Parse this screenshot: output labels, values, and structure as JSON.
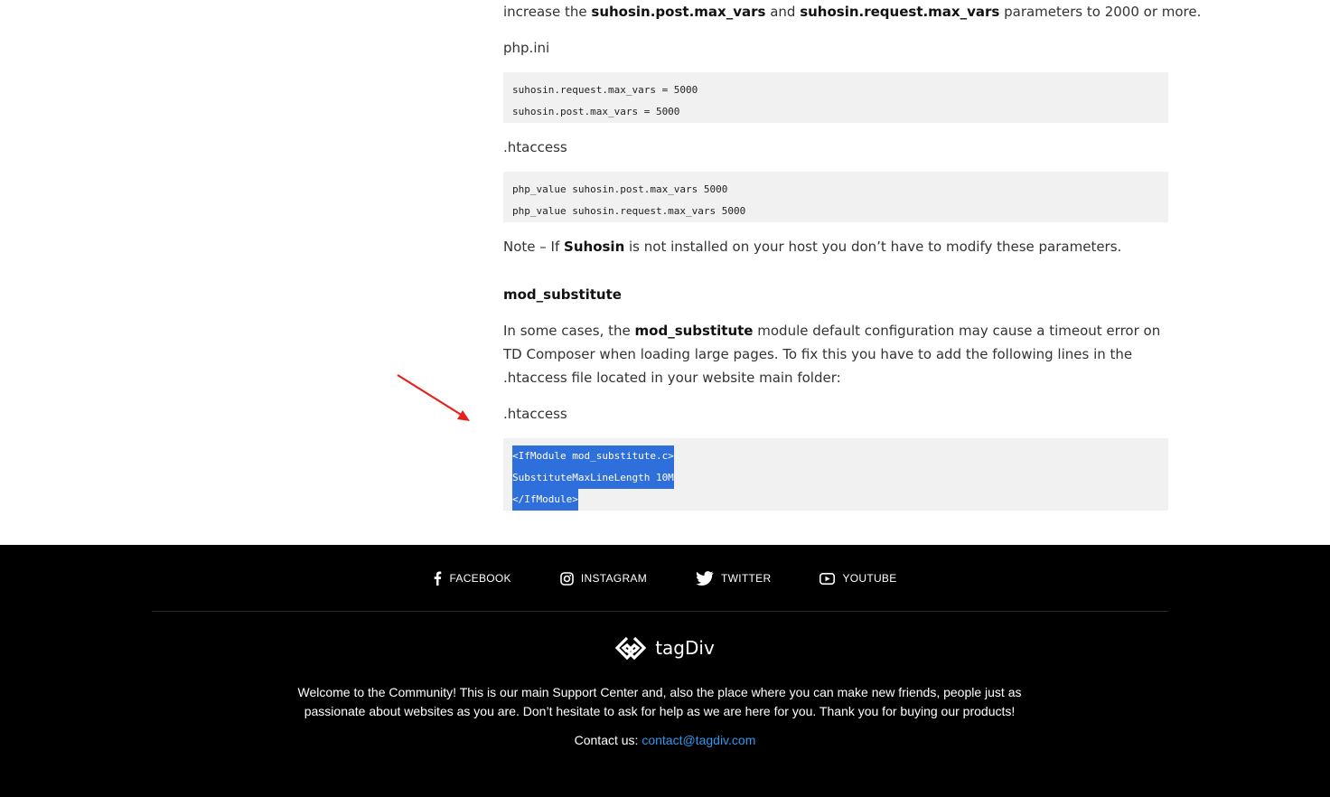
{
  "article": {
    "intro": {
      "pre": "increase the ",
      "b1": "suhosin.post.max_vars",
      "mid": " and ",
      "b2": "suhosin.request.max_vars",
      "post": " parameters to 2000 or more."
    },
    "phpini_label": "php.ini",
    "phpini_code": [
      "suhosin.request.max_vars = 5000",
      "suhosin.post.max_vars = 5000"
    ],
    "htaccess_label1": ".htaccess",
    "htaccess_code1": [
      "php_value suhosin.post.max_vars 5000",
      "php_value suhosin.request.max_vars 5000"
    ],
    "note": {
      "pre": "Note – If ",
      "b": "Suhosin",
      "post": " is not installed on your host you don’t have to modify these parameters."
    },
    "subheading": "mod_substitute",
    "paragraph": {
      "pre": "In some cases, the ",
      "b": "mod_substitute",
      "post": " module default configuration may cause a timeout error on TD Composer when loading large pages. To fix this you have to add the following lines in the .htaccess file located in your website main folder:"
    },
    "htaccess_label2": ".htaccess",
    "htaccess_code2": [
      "<IfModule mod_substitute.c>",
      "SubstituteMaxLineLength 10M",
      "</IfModule>"
    ]
  },
  "footer": {
    "social": [
      {
        "label": "FACEBOOK",
        "icon": "facebook-icon"
      },
      {
        "label": "INSTAGRAM",
        "icon": "instagram-icon"
      },
      {
        "label": "TWITTER",
        "icon": "twitter-icon"
      },
      {
        "label": "YOUTUBE",
        "icon": "youtube-icon"
      }
    ],
    "brand": "tagDiv",
    "welcome": "Welcome to the Community! This is our main Support Center and, also the place where you can make new friends, people just as passionate about websites as you are. Don’t hesitate to ask for help as we are here for you. Thank you for buying our products!",
    "contact_label": "Contact us:",
    "contact_email": "contact@tagdiv.com"
  },
  "colors": {
    "selection": "#2f6fdc",
    "code_bg": "#f1f1f1",
    "footer_bg": "#000000",
    "link": "#2f98f0",
    "arrow": "#e8201c"
  }
}
